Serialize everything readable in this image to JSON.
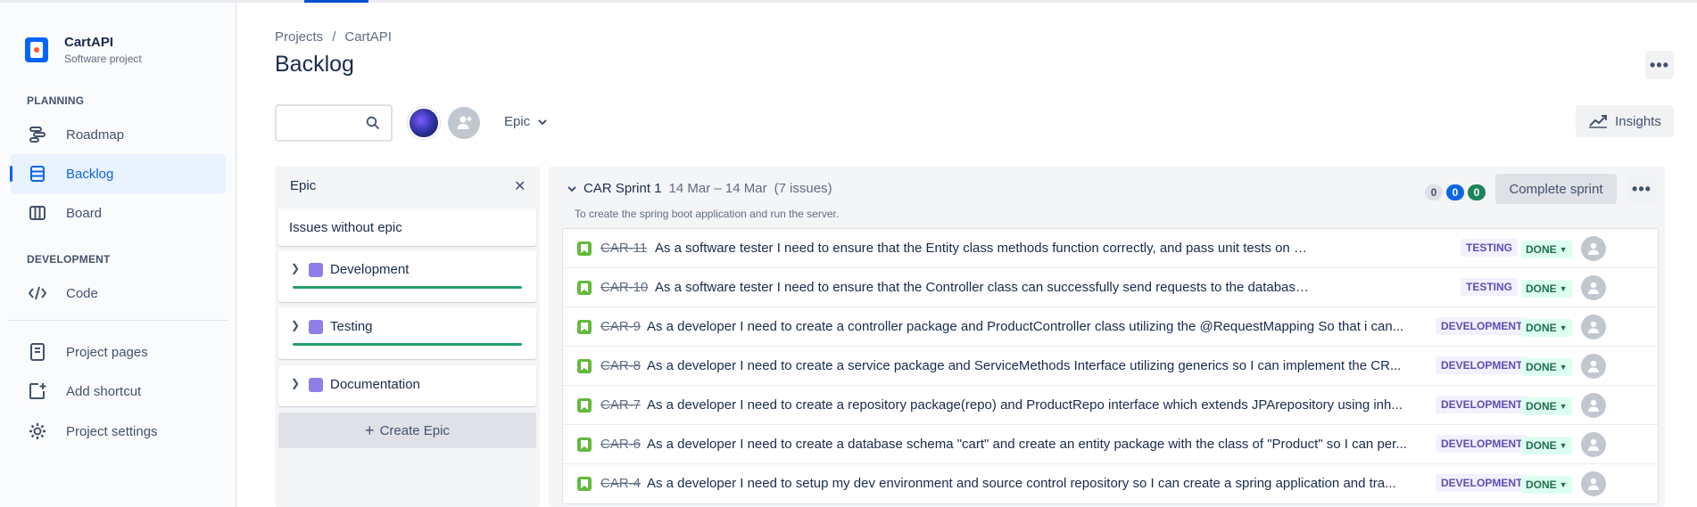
{
  "project": {
    "name": "CartAPI",
    "type": "Software project"
  },
  "sidebar": {
    "planning_label": "PLANNING",
    "development_label": "DEVELOPMENT",
    "items": [
      {
        "label": "Roadmap",
        "icon": "roadmap-icon"
      },
      {
        "label": "Backlog",
        "icon": "backlog-icon",
        "active": true
      },
      {
        "label": "Board",
        "icon": "board-icon"
      },
      {
        "label": "Code",
        "icon": "code-icon"
      },
      {
        "label": "Project pages",
        "icon": "pages-icon"
      },
      {
        "label": "Add shortcut",
        "icon": "add-shortcut-icon"
      },
      {
        "label": "Project settings",
        "icon": "gear-icon"
      }
    ]
  },
  "breadcrumb": {
    "projects": "Projects",
    "sep": "/",
    "project": "CartAPI"
  },
  "page": {
    "title": "Backlog",
    "more": "•••"
  },
  "toolbar": {
    "search_placeholder": "",
    "epic_filter": "Epic",
    "insights": "Insights"
  },
  "epic_panel": {
    "title": "Epic",
    "close": "✕",
    "issues_without_epic": "Issues without epic",
    "epics": [
      {
        "name": "Development",
        "color": "#8f7ee7",
        "progress": 1.0
      },
      {
        "name": "Testing",
        "color": "#8f7ee7",
        "progress": 1.0
      },
      {
        "name": "Documentation",
        "color": "#8f7ee7",
        "progress": 0
      }
    ],
    "create_epic": "Create Epic"
  },
  "sprint": {
    "name": "CAR Sprint 1",
    "dates": "14 Mar – 14 Mar",
    "count": "(7 issues)",
    "goal": "To create the spring boot application and run the server.",
    "counts": {
      "todo": "0",
      "in_progress": "0",
      "done": "0"
    },
    "complete_button": "Complete sprint",
    "more": "•••",
    "issues": [
      {
        "key": "CAR-11",
        "summary": "As a software tester I need to ensure that the Entity class methods function correctly, and pass unit tests on each method. So I can...",
        "epic": "TESTING",
        "status": "DONE"
      },
      {
        "key": "CAR-10",
        "summary": "As a software tester I need to ensure that the Controller class can successfully send requests to the database and as such Create, ...",
        "epic": "TESTING",
        "status": "DONE"
      },
      {
        "key": "CAR-9",
        "summary": "As a developer I need to create a controller package and ProductController class utilizing the @RequestMapping So that i can...",
        "epic": "DEVELOPMENT",
        "status": "DONE"
      },
      {
        "key": "CAR-8",
        "summary": "As a developer I need to create a service package and ServiceMethods Interface utilizing generics so I can implement the CR...",
        "epic": "DEVELOPMENT",
        "status": "DONE"
      },
      {
        "key": "CAR-7",
        "summary": "As a developer I need to create a repository package(repo) and ProductRepo interface which extends JPArepository using inh...",
        "epic": "DEVELOPMENT",
        "status": "DONE"
      },
      {
        "key": "CAR-6",
        "summary": "As a developer I need to create a database schema \"cart\" and create an entity package with the class of \"Product\" so I can per...",
        "epic": "DEVELOPMENT",
        "status": "DONE"
      },
      {
        "key": "CAR-4",
        "summary": "As a developer I need to setup my dev environment and source control repository so I can create a spring application and tra...",
        "epic": "DEVELOPMENT",
        "status": "DONE"
      }
    ]
  }
}
